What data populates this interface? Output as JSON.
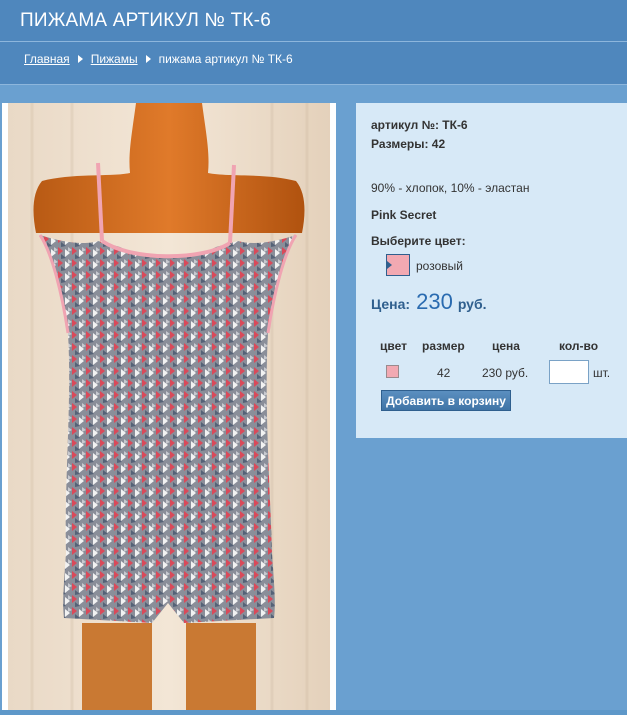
{
  "header": {
    "title": "ПИЖАМА АРТИКУЛ № ТК-6",
    "breadcrumb": [
      {
        "label": "Главная"
      },
      {
        "label": "Пижамы"
      },
      {
        "label": "пижама артикул № ТК-6"
      }
    ]
  },
  "product": {
    "article_line": "артикул №: ТК-6",
    "sizes_line": "Размеры: 42",
    "composition": "90% - хлопок, 10% - эластан",
    "brand": "Pink Secret",
    "choose_color_label": "Выберите цвет:",
    "color": {
      "name": "розовый",
      "hex": "#f2a9b2"
    },
    "price_label": "Цена:",
    "price_value": "230",
    "price_currency": "руб.",
    "table": {
      "headers": [
        "цвет",
        "размер",
        "цена",
        "кол-во"
      ],
      "row": {
        "size": "42",
        "price": "230 руб.",
        "quantity": "",
        "unit": "шт."
      }
    },
    "add_button": "Добавить в корзину"
  },
  "colors": {
    "header_bg": "#4f87bd",
    "content_bg": "#6aa0d0",
    "panel_bg": "#d7e9f7",
    "price_accent": "#2a6bb0"
  }
}
